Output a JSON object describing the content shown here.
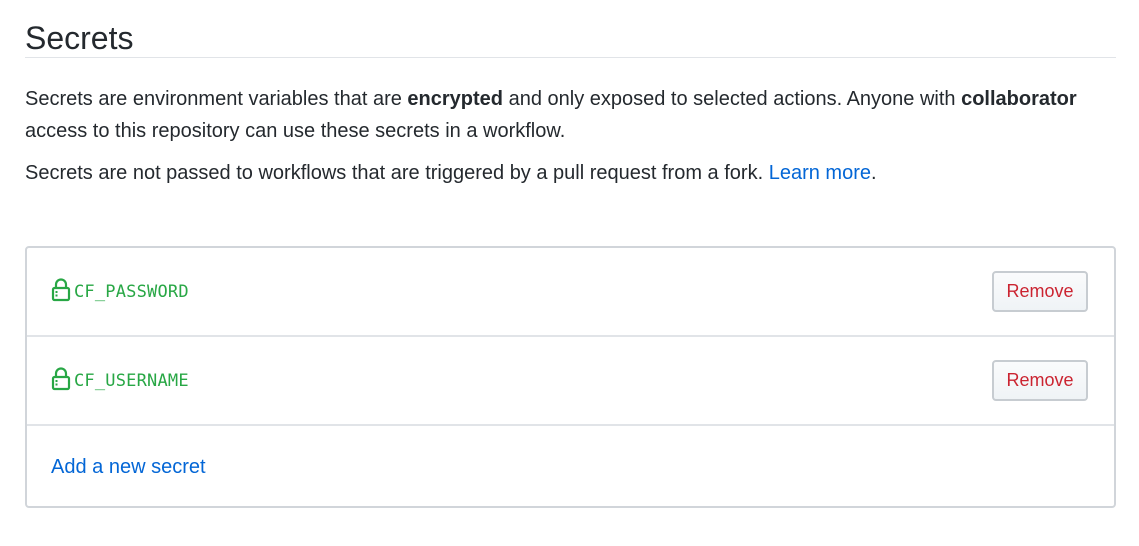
{
  "header": {
    "title": "Secrets"
  },
  "intro": {
    "part1": "Secrets are environment variables that are ",
    "bold1": "encrypted",
    "part2": " and only exposed to selected actions. Anyone with ",
    "bold2": "collaborator",
    "part3": " access to this repository can use these secrets in a workflow."
  },
  "note": {
    "text": "Secrets are not passed to workflows that are triggered by a pull request from a fork. ",
    "link_label": "Learn more",
    "suffix": "."
  },
  "secrets": [
    {
      "name": "CF_PASSWORD",
      "icon": "lock-icon",
      "remove_label": "Remove"
    },
    {
      "name": "CF_USERNAME",
      "icon": "lock-icon",
      "remove_label": "Remove"
    }
  ],
  "add_secret": {
    "label": "Add a new secret"
  },
  "colors": {
    "link": "#0366d6",
    "secret_name": "#28a745",
    "remove_text": "#cb2431",
    "text": "#24292e",
    "border": "#d1d5da"
  }
}
